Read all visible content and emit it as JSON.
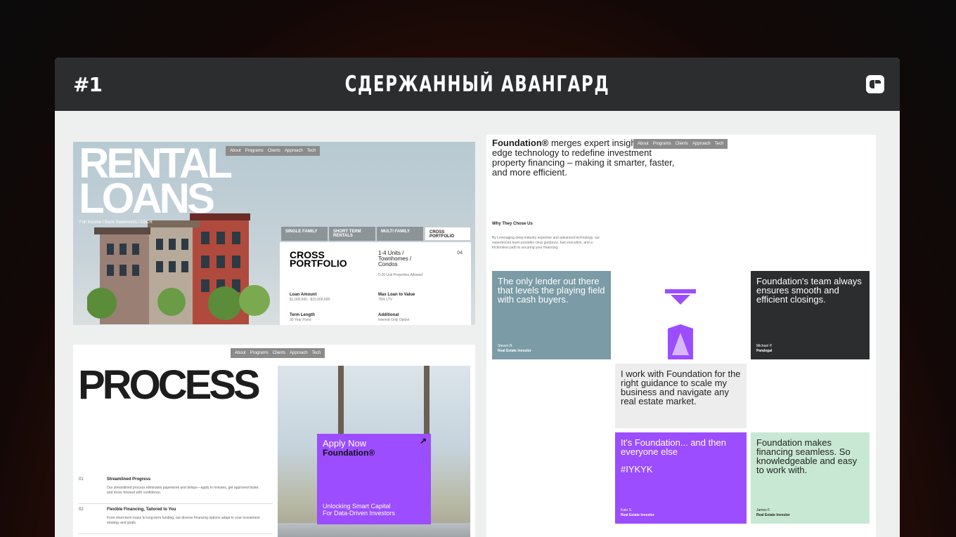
{
  "header": {
    "number": "#1",
    "title": "СДЕРЖАННЫЙ АВАНГАРД",
    "icon": "app-logo-icon"
  },
  "nav": [
    "About",
    "Programs",
    "Clients",
    "Approach",
    "Tech"
  ],
  "rental": {
    "headline_1": "RENTAL",
    "headline_2": "LOANS",
    "breadcrumb": "Full Income  /  Bank Statements  /  DSCR",
    "tabs": [
      "SINGLE FAMILY",
      "SHORT TERM RENTALS",
      "MULTI FAMILY",
      "CROSS PORTFOLIO"
    ],
    "card_title_1": "CROSS",
    "card_title_2": "PORTFOLIO",
    "card_number": "04",
    "units_1": "1-4 Units /",
    "units_2": "Townhomes /",
    "units_3": "Condos",
    "units_note": "5-20 Unit Properties Allowed",
    "loan_amount_label": "Loan Amount",
    "loan_amount_value": "$1,000,000 - $15,000,000",
    "ltv_label": "Max Loan to Value",
    "ltv_value": "75% LTV",
    "term_label": "Term Length",
    "term_value": "30 Year Fixed",
    "additional_label": "Additional",
    "additional_value": "Interest Only Option"
  },
  "process": {
    "headline": "PROCESS",
    "apply_1": "Apply Now",
    "apply_2": "Foundation®",
    "apply_arrow": "↗",
    "apply_sub_1": "Unlocking Smart Capital",
    "apply_sub_2": "For Data-Driven Investors",
    "steps": [
      {
        "n": "01",
        "title": "Streamlined Progress",
        "desc": "Our streamlined process eliminates paperwork and delays—apply in minutes, get approved faster, and move forward with confidence."
      },
      {
        "n": "02",
        "title": "Flexible Financing, Tailored to You",
        "desc": "From short-term loans to long-term funding, our diverse financing options adapt to your investment strategy and goals."
      }
    ]
  },
  "foundation": {
    "intro_brand": "Foundation®",
    "intro_text": " merges expert insight cutting-edge technology to redefine investment property financing – making it smarter, faster, and more efficient.",
    "why_title": "Why They Chose Us",
    "why_desc": "By Leveraging deep industry expertise and advanced technology, our experienced team provides clear guidance, fast execution, and a frictionless path to securing your financing.",
    "tiles": [
      {
        "quote": "The only lender out there that levels the playing field with cash buyers.",
        "name": "Steven B.",
        "role": "Real Estate Investor"
      },
      {
        "quote": "Foundation's team always ensures smooth and efficient closings.",
        "name": "Michael P.",
        "role": "Paralegal"
      },
      {
        "quote": "I work with Foundation for the right guidance to scale my business and navigate any real estate market.",
        "name": "",
        "role": ""
      },
      {
        "quote": "It's Foundation... and then everyone else",
        "tag": "#IYKYK",
        "name": "Kate S.",
        "role": "Real Estate Investor"
      },
      {
        "quote": "Foundation makes financing seamless. So knowledgeable and easy to work with.",
        "name": "James F.",
        "role": "Real Estate Investor"
      }
    ]
  },
  "colors": {
    "purple": "#9b4dff",
    "slate": "#7b9ba6",
    "dark": "#2c2d2f",
    "mint": "#c9e8d3",
    "gray": "#ededed"
  }
}
